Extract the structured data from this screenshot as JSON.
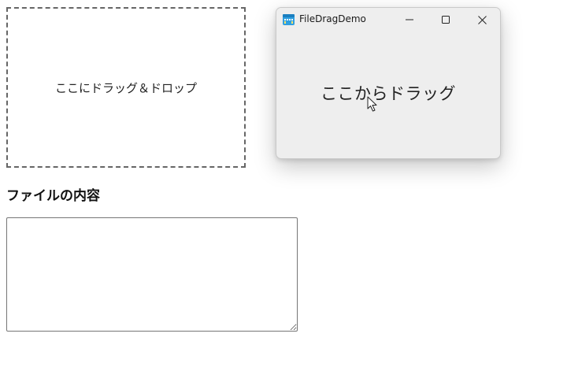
{
  "drop_zone": {
    "label": "ここにドラッグ＆ドロップ"
  },
  "file_contents": {
    "heading": "ファイルの内容",
    "textarea_value": ""
  },
  "app_window": {
    "title": "FileDragDemo",
    "icon": "app-icon",
    "controls": {
      "minimize_icon": "minimize-icon",
      "maximize_icon": "maximize-icon",
      "close_icon": "close-icon"
    },
    "drag_source_label": "ここからドラッグ"
  },
  "cursor": {
    "icon": "arrow-cursor-icon"
  },
  "colors": {
    "window_bg": "#eeeeee",
    "accent_icon_blue": "#2f9fe0",
    "dashed_border": "#666666"
  }
}
